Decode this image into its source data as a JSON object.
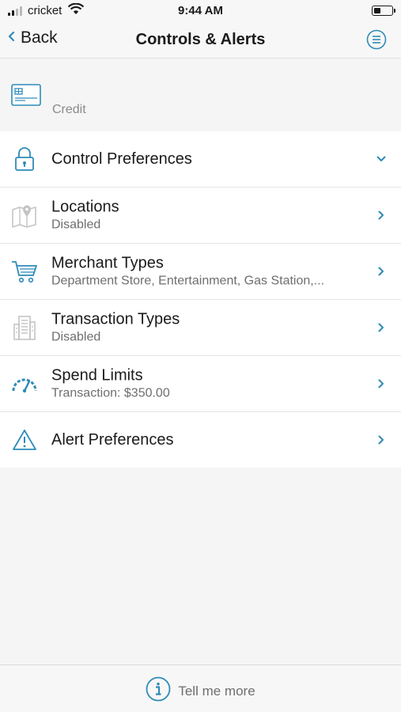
{
  "status_bar": {
    "carrier": "cricket",
    "time": "9:44 AM",
    "icons": [
      "signal-icon",
      "wifi-icon",
      "battery-icon"
    ]
  },
  "nav": {
    "back_label": "Back",
    "title": "Controls & Alerts",
    "icons": [
      "chevron-left-icon",
      "menu-icon"
    ]
  },
  "card": {
    "label": "Credit",
    "icon": "credit-card-icon"
  },
  "list": {
    "items": [
      {
        "title": "Control Preferences",
        "subtitle": "",
        "icon": "lock-icon",
        "chevron": "chevron-down-icon"
      },
      {
        "title": "Locations",
        "subtitle": "Disabled",
        "icon": "map-pin-icon",
        "chevron": "chevron-right-icon"
      },
      {
        "title": "Merchant Types",
        "subtitle": "Department Store, Entertainment, Gas Station,...",
        "icon": "shopping-cart-icon",
        "chevron": "chevron-right-icon"
      },
      {
        "title": "Transaction Types",
        "subtitle": "Disabled",
        "icon": "building-icon",
        "chevron": "chevron-right-icon"
      },
      {
        "title": "Spend Limits",
        "subtitle": "Transaction: $350.00",
        "icon": "gauge-icon",
        "chevron": "chevron-right-icon"
      },
      {
        "title": "Alert Preferences",
        "subtitle": "",
        "icon": "warning-icon",
        "chevron": "chevron-right-icon"
      }
    ]
  },
  "footer": {
    "label": "Tell me more",
    "icon": "info-icon"
  },
  "colors": {
    "accent": "#2d8bb8",
    "disabled_icon": "#c4c4c4",
    "background": "#f5f5f5",
    "row_background": "#ffffff",
    "subtitle": "#6e6e6e"
  }
}
